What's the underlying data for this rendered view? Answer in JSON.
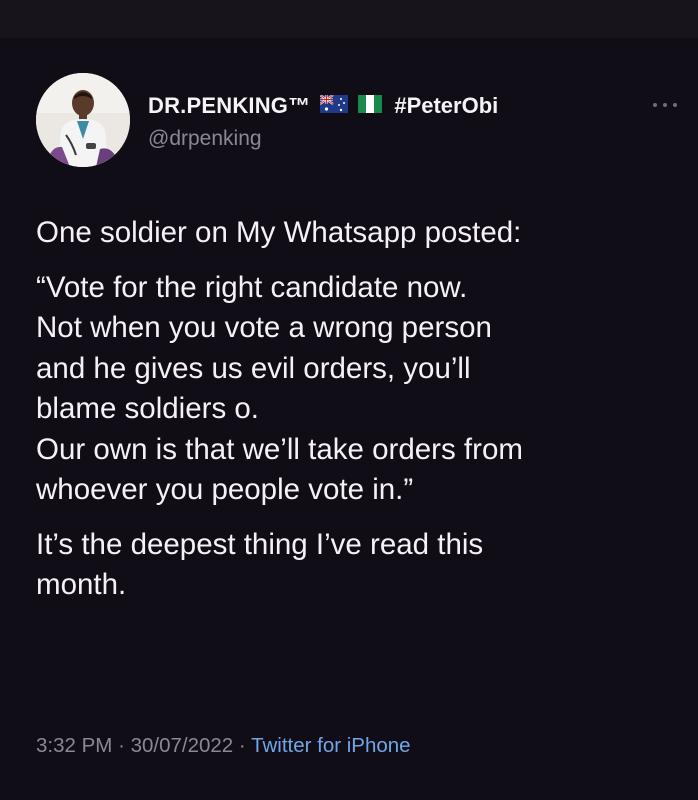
{
  "tweet": {
    "author": {
      "display_name": "DR.PENKING™",
      "flags": [
        "flag-australia-icon",
        "flag-nigeria-icon"
      ],
      "hashtag": "#PeterObi",
      "handle": "@drpenking"
    },
    "more_icon": "more-horizontal-icon",
    "body": [
      "One soldier on My Whatsapp posted:",
      "“Vote for the right candidate now.",
      "Not when you vote a wrong person",
      "and he gives us evil orders, you’ll",
      "blame soldiers o.",
      "Our own is that we’ll take orders from",
      "whoever you people vote in.”",
      "It’s the deepest thing I’ve read this",
      "month."
    ],
    "time": "3:32 PM",
    "separator": "·",
    "date": "30/07/2022",
    "source": "Twitter for iPhone"
  },
  "colors": {
    "background": "#110d17",
    "text": "#f3f3f5",
    "muted": "#8b8796",
    "link": "#6fa6e8"
  }
}
